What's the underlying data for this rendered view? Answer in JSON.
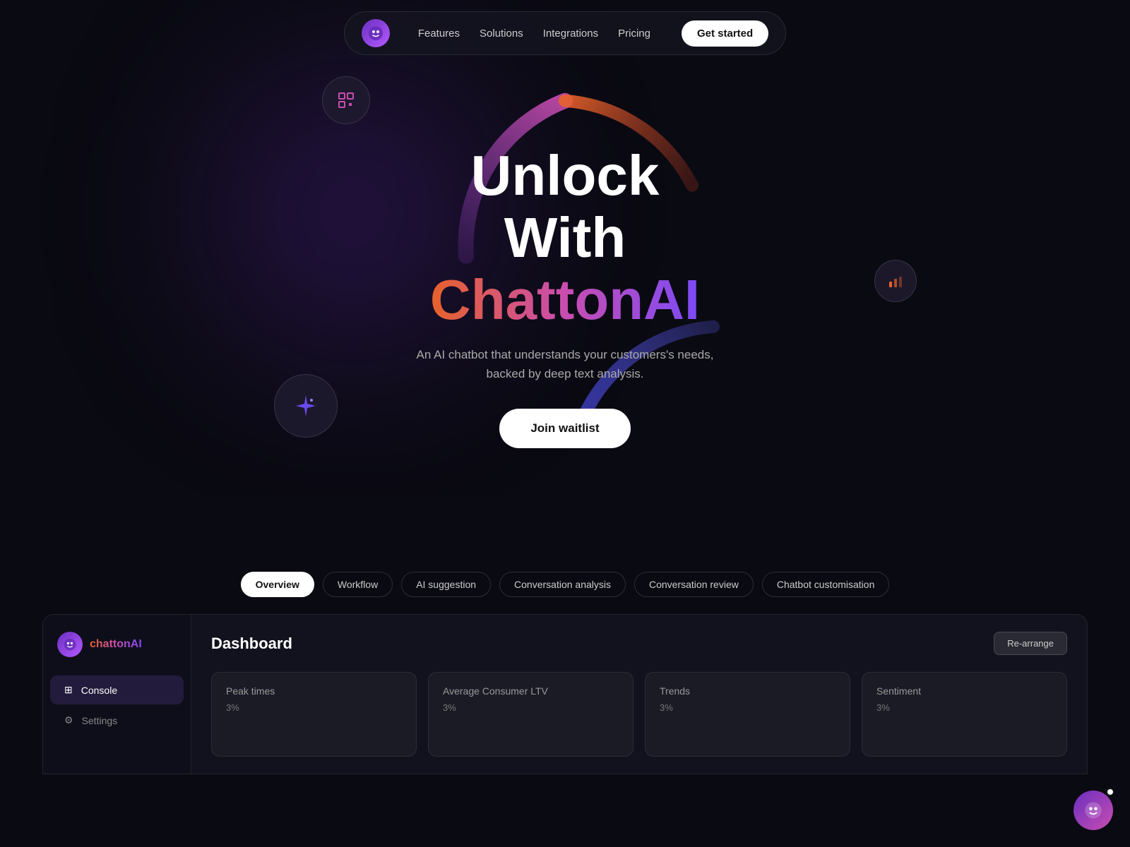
{
  "nav": {
    "logo_emoji": "🎭",
    "links": [
      "Features",
      "Solutions",
      "Integrations",
      "Pricing"
    ],
    "cta_label": "Get started"
  },
  "hero": {
    "title_line1": "Unlock",
    "title_line2": "With",
    "title_brand": "ChattonAI",
    "subtitle": "An AI chatbot that understands your customers's needs, backed by deep text analysis.",
    "cta_label": "Join waitlist",
    "scan_icon": "⊡",
    "chart_icon": "📊",
    "sparkle_icon": "✦"
  },
  "tabs": [
    {
      "label": "Overview",
      "active": true
    },
    {
      "label": "Workflow",
      "active": false
    },
    {
      "label": "AI suggestion",
      "active": false
    },
    {
      "label": "Conversation analysis",
      "active": false
    },
    {
      "label": "Conversation review",
      "active": false
    },
    {
      "label": "Chatbot customisation",
      "active": false
    }
  ],
  "dashboard": {
    "title": "Dashboard",
    "rearrange_label": "Re-arrange",
    "sidebar": {
      "brand": "chattonAI",
      "items": [
        {
          "label": "Console",
          "icon": "⊞",
          "active": true
        },
        {
          "label": "Settings",
          "icon": "⚙",
          "active": false
        }
      ]
    },
    "cards": [
      {
        "title": "Peak times",
        "value": "3%"
      },
      {
        "title": "Average Consumer LTV",
        "value": "3%"
      },
      {
        "title": "Trends",
        "value": "3%"
      },
      {
        "title": "Sentiment",
        "value": "3%"
      }
    ]
  },
  "chat_bubble": {
    "icon": "🎭"
  },
  "footer_label": "Average Consumer"
}
